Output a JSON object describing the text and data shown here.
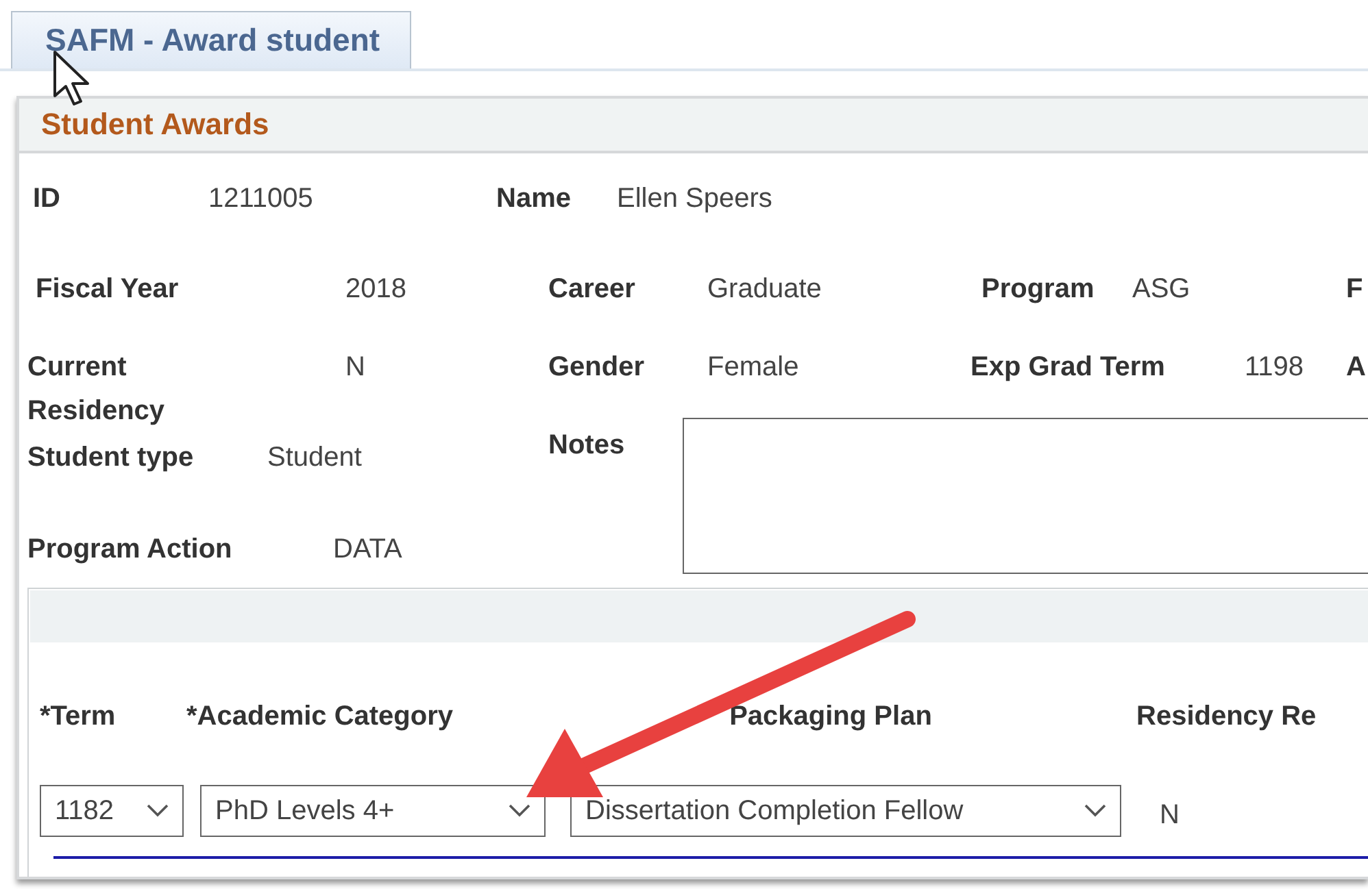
{
  "tab": {
    "label": "SAFM - Award student",
    "selected": true
  },
  "panel": {
    "title": "Student Awards"
  },
  "fields": [
    [
      {
        "kind": "label",
        "text": "ID"
      },
      {
        "kind": "value",
        "text": "1211005"
      },
      {
        "kind": "label",
        "text": "Name"
      },
      {
        "kind": "value",
        "text": "Ellen Speers"
      }
    ],
    [
      {
        "kind": "label",
        "text": "Fiscal Year"
      },
      {
        "kind": "value",
        "text": "2018"
      },
      {
        "kind": "label",
        "text": "Career"
      },
      {
        "kind": "value",
        "text": "Graduate"
      },
      {
        "kind": "label",
        "text": "Program"
      },
      {
        "kind": "value",
        "text": "ASG"
      },
      {
        "kind": "label",
        "text": "F"
      }
    ],
    [
      {
        "kind": "label",
        "text": "Current Residency"
      },
      {
        "kind": "value",
        "text": "N"
      },
      {
        "kind": "label",
        "text": "Gender"
      },
      {
        "kind": "value",
        "text": "Female"
      },
      {
        "kind": "label",
        "text": "Exp Grad Term"
      },
      {
        "kind": "value",
        "text": "1198"
      },
      {
        "kind": "label",
        "text": "A"
      }
    ]
  ],
  "side_fields": [
    [
      {
        "kind": "label",
        "text": "Student type"
      },
      {
        "kind": "value",
        "text": "Student"
      }
    ],
    [
      {
        "kind": "label",
        "text": "Program Action"
      },
      {
        "kind": "value",
        "text": "DATA"
      }
    ]
  ],
  "notes": {
    "label": "Notes"
  },
  "grid": {
    "columns": [
      "*Term",
      "*Academic Category",
      "Packaging Plan",
      "Residency Re"
    ],
    "rows": [
      {
        "term": "1182",
        "academic_category": "PhD Levels 4+",
        "packaging_plan": "Dissertation Completion Fellow",
        "residency": "N"
      }
    ]
  }
}
